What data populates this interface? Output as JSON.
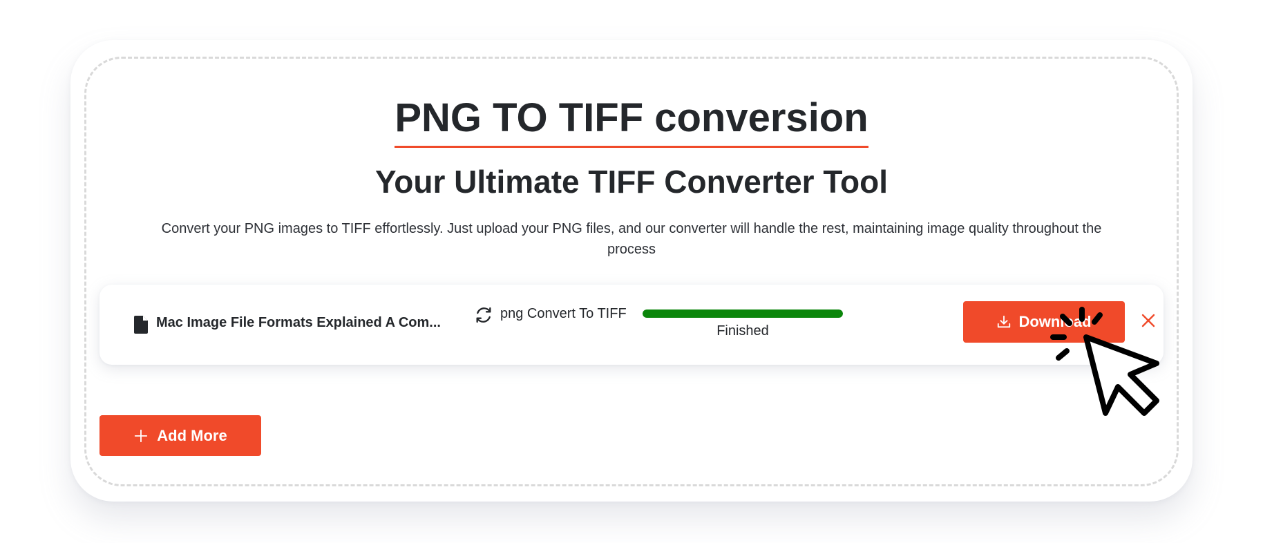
{
  "page": {
    "title": "PNG TO TIFF conversion",
    "subtitle": "Your Ultimate TIFF Converter Tool",
    "description": "Convert your PNG images to TIFF effortlessly. Just upload your PNG files, and our converter will handle the rest, maintaining image quality throughout the process"
  },
  "file_item": {
    "file_name": "Mac Image File Formats Explained A Com...",
    "file_icon": "document-icon",
    "conversion_label": "png Convert To TIFF",
    "conversion_icon": "refresh-icon",
    "progress": 1.0,
    "status": "Finished",
    "download_label": "Download",
    "download_icon": "download-icon",
    "remove_icon": "close-icon"
  },
  "actions": {
    "add_more_label": "Add More",
    "add_more_icon": "plus-icon"
  },
  "colors": {
    "accent": "#f04a2a",
    "progress": "#0b860b",
    "text": "#24272b"
  }
}
